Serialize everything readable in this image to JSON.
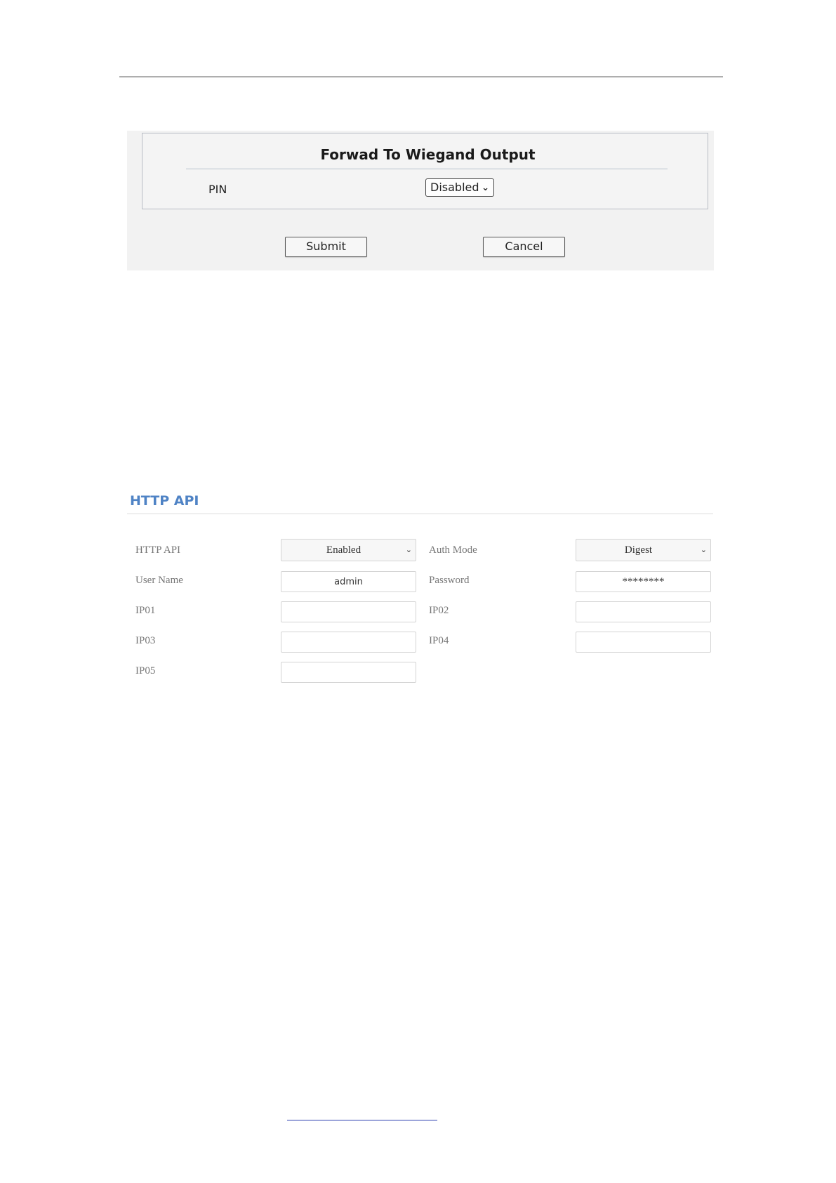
{
  "wiegand": {
    "title": "Forwad To Wiegand Output",
    "pin_label": "PIN",
    "pin_value": "Disabled",
    "submit_label": "Submit",
    "cancel_label": "Cancel"
  },
  "http_api": {
    "heading": "HTTP API",
    "http_api_label": "HTTP API",
    "http_api_value": "Enabled",
    "auth_mode_label": "Auth Mode",
    "auth_mode_value": "Digest",
    "user_name_label": "User Name",
    "user_name_value": "admin",
    "password_label": "Password",
    "password_value": "********",
    "ip01_label": "IP01",
    "ip01_value": "",
    "ip02_label": "IP02",
    "ip02_value": "",
    "ip03_label": "IP03",
    "ip03_value": "",
    "ip04_label": "IP04",
    "ip04_value": "",
    "ip05_label": "IP05",
    "ip05_value": ""
  },
  "colors": {
    "heading_blue": "#4f83c5",
    "footer_link": "#2b3fb0"
  }
}
